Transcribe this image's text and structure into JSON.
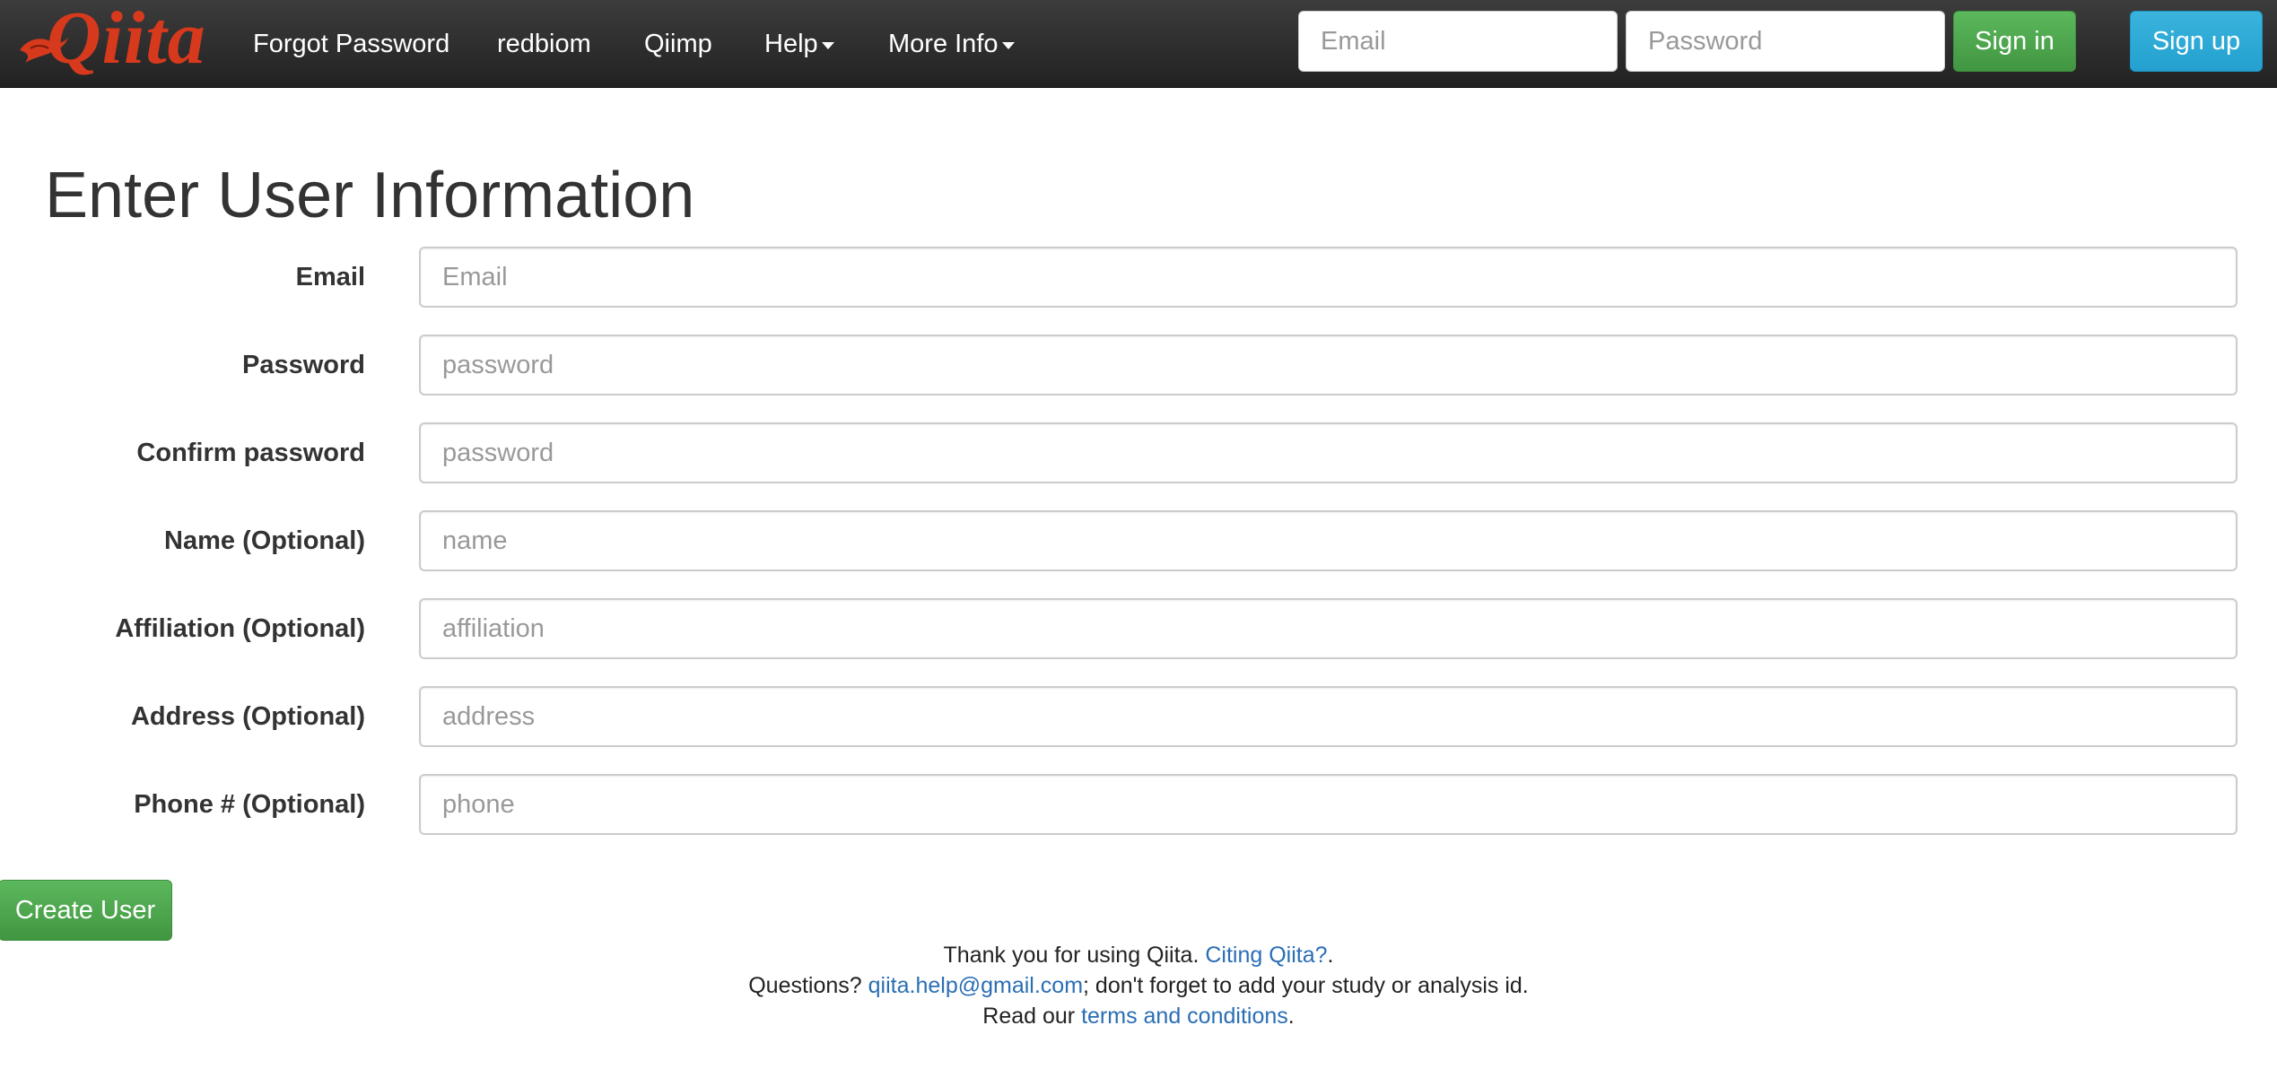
{
  "navbar": {
    "brand_text": "Qiita",
    "brand_color": "#d7391d",
    "items": [
      {
        "label": "Forgot Password",
        "has_caret": false
      },
      {
        "label": "redbiom",
        "has_caret": false
      },
      {
        "label": "Qiimp",
        "has_caret": false
      },
      {
        "label": "Help",
        "has_caret": true
      },
      {
        "label": "More Info",
        "has_caret": true
      }
    ],
    "login": {
      "email_placeholder": "Email",
      "password_placeholder": "Password",
      "sign_in_label": "Sign in",
      "sign_up_label": "Sign up"
    }
  },
  "main": {
    "title": "Enter User Information",
    "fields": [
      {
        "label": "Email",
        "placeholder": "Email",
        "value": ""
      },
      {
        "label": "Password",
        "placeholder": "password",
        "value": ""
      },
      {
        "label": "Confirm password",
        "placeholder": "password",
        "value": ""
      },
      {
        "label": "Name (Optional)",
        "placeholder": "name",
        "value": ""
      },
      {
        "label": "Affiliation (Optional)",
        "placeholder": "affiliation",
        "value": ""
      },
      {
        "label": "Address (Optional)",
        "placeholder": "address",
        "value": ""
      },
      {
        "label": "Phone # (Optional)",
        "placeholder": "phone",
        "value": ""
      }
    ],
    "submit_label": "Create User"
  },
  "footer": {
    "line1_prefix": "Thank you for using Qiita. ",
    "line1_link": "Citing Qiita?",
    "line1_suffix": ".",
    "line2_prefix": "Questions? ",
    "line2_link": "qiita.help@gmail.com",
    "line2_suffix": "; don't forget to add your study or analysis id.",
    "line3_prefix": "Read our ",
    "line3_link": "terms and conditions",
    "line3_suffix": "."
  },
  "colors": {
    "navbar_bg": "#222222",
    "success_green": "#5cb85c",
    "info_blue": "#23a0cf",
    "link_blue": "#2a6eb5"
  }
}
